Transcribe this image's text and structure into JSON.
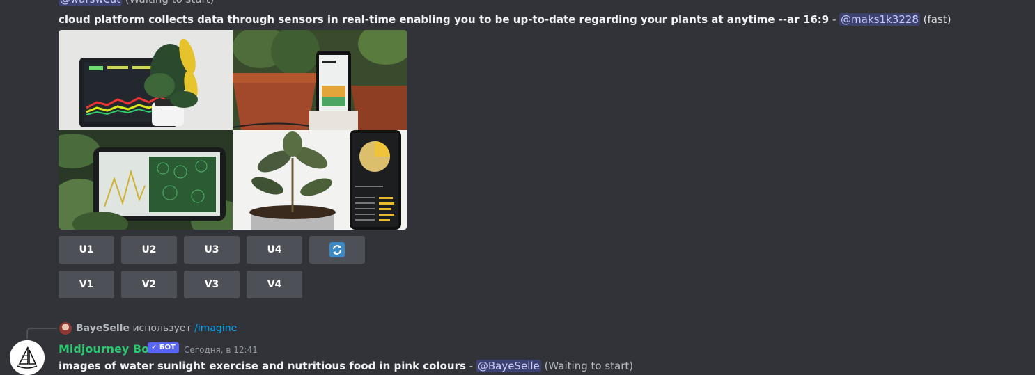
{
  "previous_message": {
    "mention": "@warsweat",
    "status": "(Waiting to start)"
  },
  "message": {
    "prompt": "cloud platform collects data through sensors in real-time enabling you to be up-to-date regarding your plants at anytime --ar 16:9",
    "separator": " - ",
    "mention": "@maks1k3228",
    "mode": "(fast)",
    "images": [
      {
        "name": "dashboard-laptop-plant"
      },
      {
        "name": "potted-plant-phone"
      },
      {
        "name": "tablet-leaves-chart"
      },
      {
        "name": "seedling-phone-app"
      }
    ],
    "buttons_row1": [
      "U1",
      "U2",
      "U3",
      "U4"
    ],
    "reroll_icon": "refresh-icon",
    "buttons_row2": [
      "V1",
      "V2",
      "V3",
      "V4"
    ]
  },
  "next_message": {
    "reply": {
      "user": "BayeSelle",
      "verb": "использует",
      "command": "/imagine"
    },
    "bot": {
      "name": "Midjourney Bot",
      "badge": "✓ БОТ",
      "timestamp": "Сегодня, в 12:41"
    },
    "prompt": "images of water sunlight exercise and nutritious food in pink colours",
    "separator": " - ",
    "mention": "@BayeSelle",
    "status": "(Waiting to start)"
  },
  "colors": {
    "background": "#313338",
    "button": "#4e5058",
    "bot_name": "#2dc770",
    "mention_bg": "#3c4270",
    "link": "#00a8fc",
    "badge": "#5865f2"
  }
}
